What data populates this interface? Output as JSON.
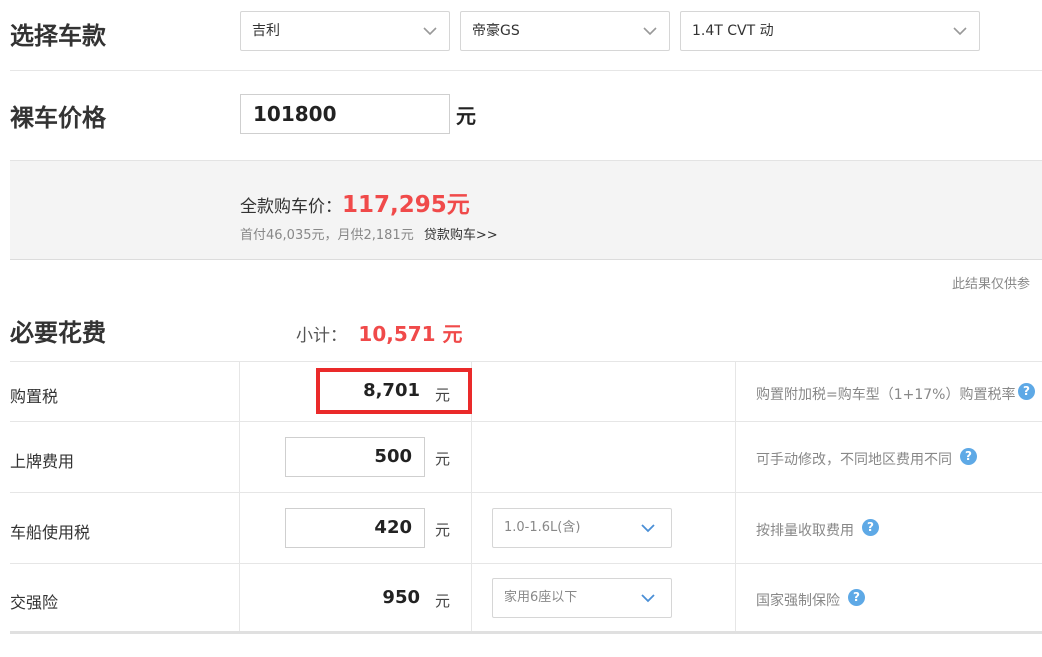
{
  "select_car": {
    "title": "选择车款",
    "brand": "吉利",
    "series": "帝豪GS",
    "model": "1.4T CVT 动"
  },
  "bare_price": {
    "title": "裸车价格",
    "value": "101800",
    "unit": "元"
  },
  "summary": {
    "full_label": "全款购车价：",
    "full_value": "117,295元",
    "loan_text": "首付46,035元，月供2,181元",
    "loan_link": "贷款购车>>",
    "disclaimer": "此结果仅供参"
  },
  "required": {
    "title": "必要花费",
    "subtotal_label": "小计：",
    "subtotal_value": "10,571 元"
  },
  "rows": [
    {
      "label": "购置税",
      "value": "8,701",
      "unit": "元",
      "note": "购置附加税=购车型（1+17%）购置税率"
    },
    {
      "label": "上牌费用",
      "value": "500",
      "unit": "元",
      "note": "可手动修改，不同地区费用不同"
    },
    {
      "label": "车船使用税",
      "value": "420",
      "unit": "元",
      "option": "1.0-1.6L(含)",
      "note": "按排量收取费用"
    },
    {
      "label": "交强险",
      "value": "950",
      "unit": "元",
      "option": "家用6座以下",
      "note": "国家强制保险"
    }
  ],
  "icons": {
    "help": "?"
  },
  "colors": {
    "accent_red": "#f04a4a",
    "help_blue": "#5ea9e6",
    "highlight": "#ea2a2a"
  }
}
